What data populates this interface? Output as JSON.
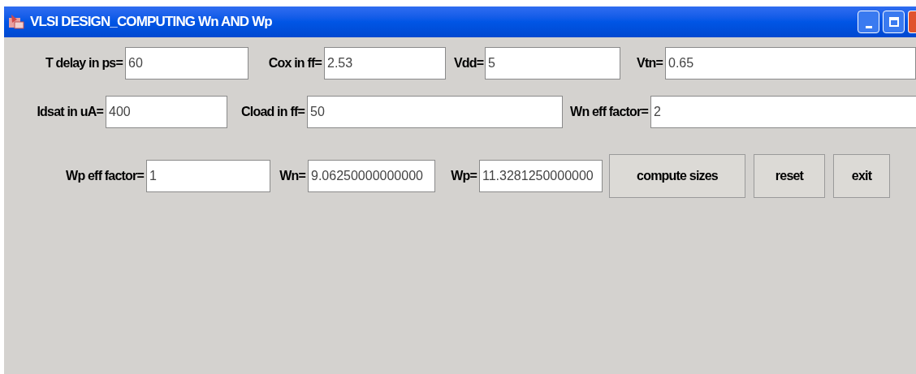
{
  "window": {
    "title": "VLSI DESIGN_COMPUTING Wn AND Wp"
  },
  "rows": [
    {
      "fields": [
        {
          "label": "T delay in ps=",
          "value": "60"
        },
        {
          "label": "Cox in ff=",
          "value": "2.53"
        },
        {
          "label": "Vdd=",
          "value": "5"
        },
        {
          "label": "Vtn=",
          "value": "0.65"
        }
      ]
    },
    {
      "fields": [
        {
          "label": "Idsat in uA=",
          "value": "400"
        },
        {
          "label": "Cload in ff=",
          "value": "50"
        },
        {
          "label": "Wn eff factor=",
          "value": "2"
        }
      ]
    },
    {
      "fields": [
        {
          "label": "Wp eff factor=",
          "value": "1"
        },
        {
          "label": "Wn=",
          "value": "9.06250000000000"
        },
        {
          "label": "Wp=",
          "value": "11.3281250000000"
        }
      ]
    }
  ],
  "buttons": [
    "compute sizes",
    "reset",
    "exit"
  ]
}
